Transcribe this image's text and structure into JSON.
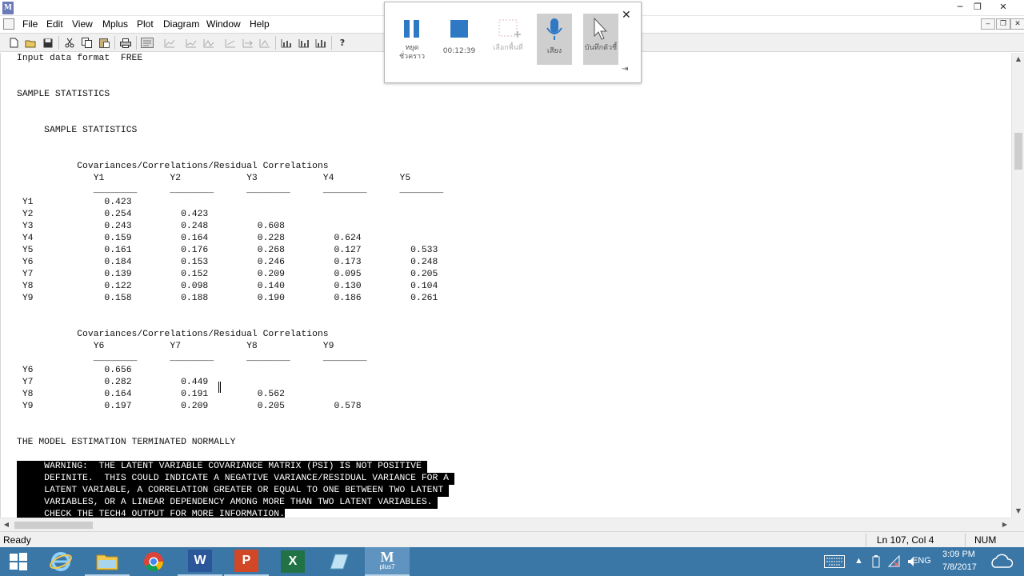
{
  "app": {
    "logo_text": "M",
    "logo_subtext": "plus7"
  },
  "window_controls": {
    "minimize": "─",
    "restore": "❐",
    "close": "✕"
  },
  "menubar": {
    "items": [
      "File",
      "Edit",
      "View",
      "Mplus",
      "Plot",
      "Diagram",
      "Window",
      "Help"
    ]
  },
  "mdi_controls": {
    "minimize": "‒",
    "restore": "❐",
    "close": "✕"
  },
  "toolbar": {
    "buttons": [
      "new-file-icon",
      "open-folder-icon",
      "save-icon",
      "cut-icon",
      "copy-icon",
      "paste-icon",
      "print-icon",
      "run-icon",
      "plot-icon",
      "plot2-icon",
      "plot3-icon",
      "plot4-icon",
      "plot5-icon",
      "plot6-icon",
      "bar-chart-icon",
      "bar-chart2-icon",
      "bar-chart3-icon",
      "bar-chart4-icon",
      "help-icon"
    ],
    "help_label": "?"
  },
  "output": {
    "lines": [
      "Input data format  FREE",
      "",
      "",
      "SAMPLE STATISTICS",
      "",
      "",
      "     SAMPLE STATISTICS",
      "",
      "",
      "           Covariances/Correlations/Residual Correlations",
      "              Y1            Y2            Y3            Y4            Y5",
      "              ________      ________      ________      ________      ________",
      " Y1             0.423",
      " Y2             0.254         0.423",
      " Y3             0.243         0.248         0.608",
      " Y4             0.159         0.164         0.228         0.624",
      " Y5             0.161         0.176         0.268         0.127         0.533",
      " Y6             0.184         0.153         0.246         0.173         0.248",
      " Y7             0.139         0.152         0.209         0.095         0.205",
      " Y8             0.122         0.098         0.140         0.130         0.104",
      " Y9             0.158         0.188         0.190         0.186         0.261",
      "",
      "",
      "           Covariances/Correlations/Residual Correlations",
      "              Y6            Y7            Y8            Y9",
      "              ________      ________      ________      ________",
      " Y6             0.656",
      " Y7             0.282         0.449",
      " Y8             0.164         0.191         0.562",
      " Y9             0.197         0.209         0.205         0.578",
      "",
      "",
      "THE MODEL ESTIMATION TERMINATED NORMALLY",
      ""
    ],
    "warning_lines": [
      "     WARNING:  THE LATENT VARIABLE COVARIANCE MATRIX (PSI) IS NOT POSITIVE ",
      "     DEFINITE.  THIS COULD INDICATE A NEGATIVE VARIANCE/RESIDUAL VARIANCE FOR A ",
      "     LATENT VARIABLE, A CORRELATION GREATER OR EQUAL TO ONE BETWEEN TWO LATENT ",
      "     VARIABLES, OR A LINEAR DEPENDENCY AMONG MORE THAN TWO LATENT VARIABLES. ",
      "     CHECK THE TECH4 OUTPUT FOR MORE INFORMATION."
    ]
  },
  "statusbar": {
    "ready": "Ready",
    "position": "Ln 107, Col 4",
    "num": "NUM"
  },
  "recorder": {
    "pause_label": "หยุดชั่วคราว",
    "timer": "00:12:39",
    "select_area_label": "เลือกพื้นที่",
    "audio_label": "เสียง",
    "record_pointer_label": "บันทึกตัวชี้",
    "close": "✕",
    "pin": "⇥"
  },
  "taskbar": {
    "apps": [
      "start",
      "internet-explorer",
      "file-explorer",
      "chrome",
      "word",
      "powerpoint",
      "excel",
      "notes",
      "mplus"
    ],
    "mplus_label": "M",
    "mplus_sublabel": "plus7",
    "word_label": "W",
    "powerpoint_label": "P",
    "excel_label": "X",
    "language": "ENG",
    "time": "3:09 PM",
    "date": "7/8/2017"
  },
  "colors": {
    "taskbar": "#3a76a6",
    "warning_bg": "#000000",
    "warning_text": "#ffffff",
    "word": "#2b579a",
    "powerpoint": "#d24726",
    "excel": "#217346"
  }
}
